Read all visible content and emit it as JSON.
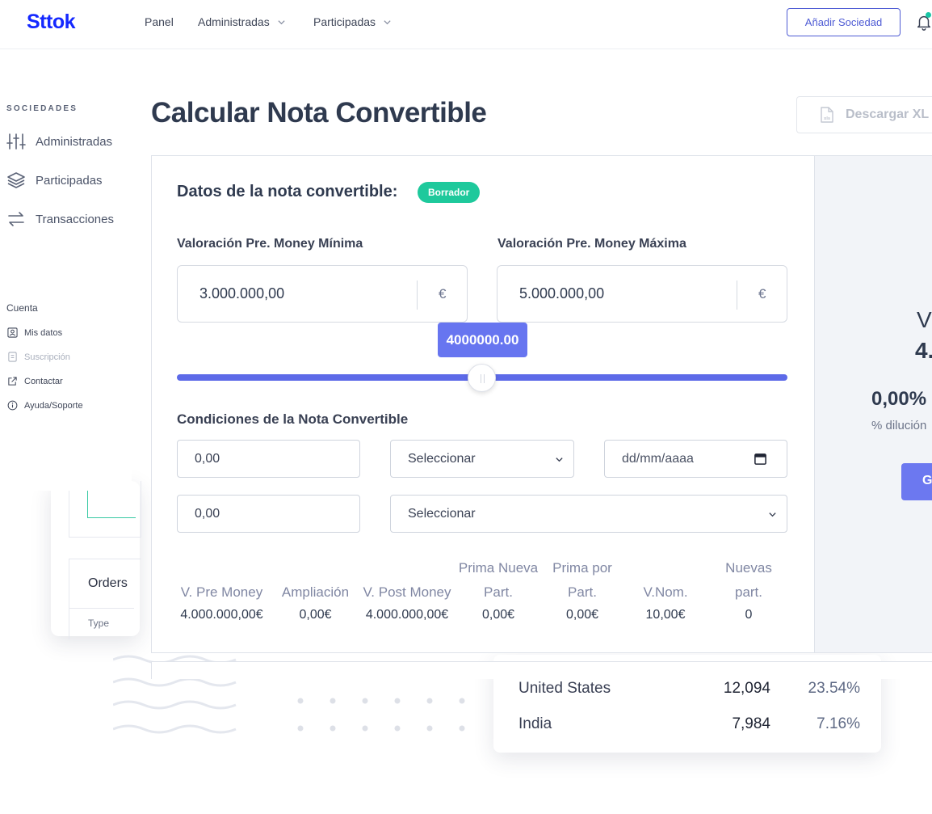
{
  "nav": {
    "brand": "Sttok",
    "items": [
      {
        "label": "Panel"
      },
      {
        "label": "Administradas"
      },
      {
        "label": "Participadas"
      }
    ],
    "add_button": "Añadir Sociedad"
  },
  "sidebar": {
    "heading": "SOCIEDADES",
    "items": [
      {
        "label": "Administradas",
        "icon": "sliders-icon"
      },
      {
        "label": "Participadas",
        "icon": "layers-icon"
      },
      {
        "label": "Transacciones",
        "icon": "arrows-exchange-icon"
      }
    ],
    "account_heading": "Cuenta",
    "account_items": [
      {
        "label": "Mis datos",
        "icon": "user-icon"
      },
      {
        "label": "Suscripción",
        "icon": "receipt-icon"
      },
      {
        "label": "Contactar",
        "icon": "external-link-icon"
      },
      {
        "label": "Ayuda/Soporte",
        "icon": "info-icon"
      }
    ]
  },
  "page": {
    "title": "Calcular Nota Convertible",
    "download_button": "Descargar XL"
  },
  "form": {
    "section_title": "Datos de la nota convertible:",
    "status_badge": "Borrador",
    "min_label": "Valoración Pre. Money Mínima",
    "min_value": "3.000.000,00",
    "max_label": "Valoración Pre. Money Máxima",
    "max_value": "5.000.000,00",
    "currency": "€",
    "slider_value": "4000000.00",
    "slider_fraction": 0.5,
    "conditions_title": "Condiciones de la Nota Convertible",
    "cond_input_1": "0,00",
    "cond_select_1": "Seleccionar",
    "cond_date_placeholder": "dd/mm/aaaa",
    "cond_input_2": "0,00",
    "cond_select_2": "Seleccionar"
  },
  "summary": {
    "columns": [
      {
        "header": "V. Pre Money",
        "value": "4.000.000,00€"
      },
      {
        "header": "Ampliación",
        "value": "0,00€"
      },
      {
        "header": "V. Post Money",
        "value": "4.000.000,00€"
      },
      {
        "header": "Prima Nueva Part.",
        "value": "0,00€"
      },
      {
        "header": "Prima por Part.",
        "value": "0,00€"
      },
      {
        "header": "V.Nom.",
        "value": "10,00€"
      },
      {
        "header": "Nuevas part.",
        "value": "0"
      }
    ]
  },
  "right_panel": {
    "line1": "V",
    "line2": "4.",
    "percent": "0,00%",
    "dilution_label": "% dilución",
    "button": "G"
  },
  "background": {
    "orders_title": "Orders",
    "orders_type": "Type",
    "countries": [
      {
        "name": "United States",
        "value": "12,094",
        "pct": "23.54%"
      },
      {
        "name": "India",
        "value": "7,984",
        "pct": "7.16%"
      }
    ]
  },
  "colors": {
    "brand": "#1428ff",
    "accent": "#5d6ae8",
    "badge": "#1ec99c"
  }
}
